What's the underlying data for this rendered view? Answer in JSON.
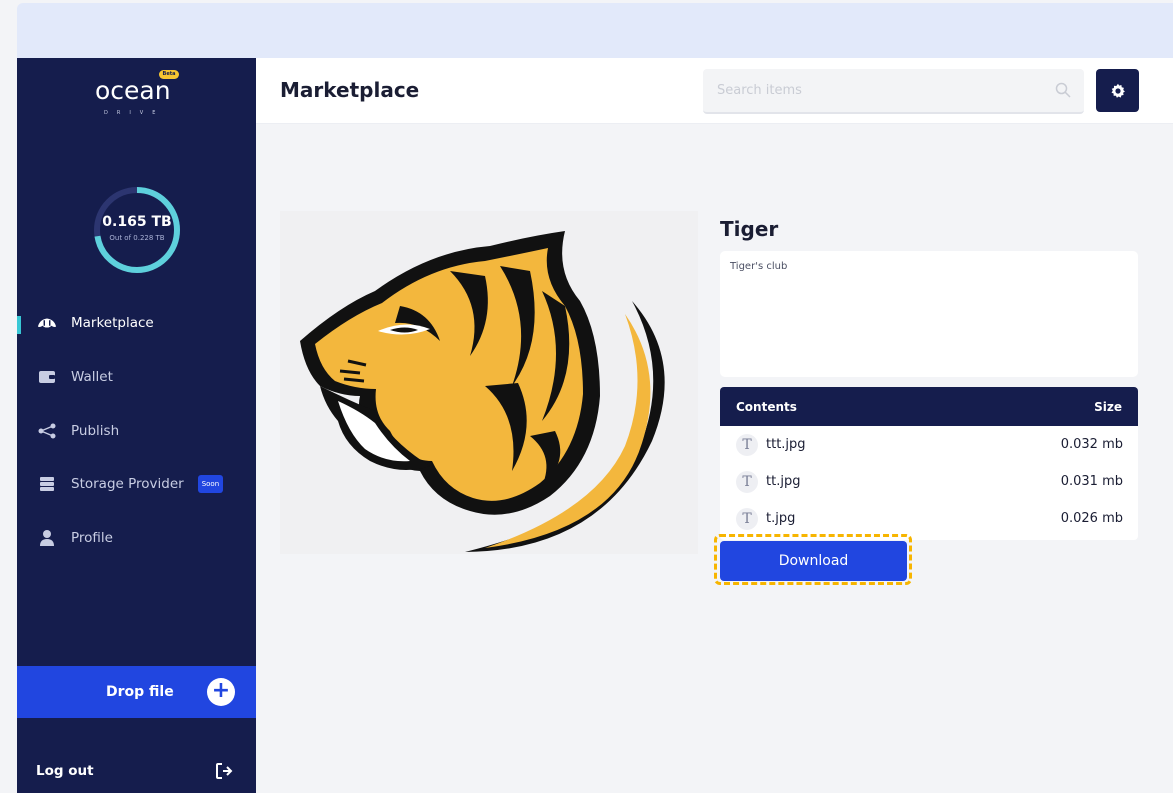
{
  "app": {
    "logo_text": "ocean",
    "logo_sub": "DRIVE",
    "logo_badge": "Beta"
  },
  "storage": {
    "used": "0.165 TB",
    "total": "Out of 0.228 TB",
    "used_fraction": 0.724,
    "ring_color": "#5ed0dc",
    "track_color": "#2c3570"
  },
  "sidebar": {
    "items": [
      {
        "label": "Marketplace",
        "icon": "tiger-mask-icon",
        "active": true
      },
      {
        "label": "Wallet",
        "icon": "wallet-icon"
      },
      {
        "label": "Publish",
        "icon": "share-icon"
      },
      {
        "label": "Storage Provider",
        "icon": "server-icon",
        "badge": "Soon"
      },
      {
        "label": "Profile",
        "icon": "user-icon"
      }
    ],
    "drop_file": "Drop file",
    "logout": "Log out"
  },
  "header": {
    "title": "Marketplace",
    "search_placeholder": "Search items"
  },
  "item": {
    "title": "Tiger",
    "description": "Tiger's club",
    "image_alt": "tiger-logo-image"
  },
  "contents": {
    "header_left": "Contents",
    "header_right": "Size",
    "files": [
      {
        "icon": "T",
        "name": "ttt.jpg",
        "size": "0.032 mb"
      },
      {
        "icon": "T",
        "name": "tt.jpg",
        "size": "0.031 mb"
      },
      {
        "icon": "T",
        "name": "t.jpg",
        "size": "0.026 mb"
      }
    ]
  },
  "download_label": "Download",
  "colors": {
    "sidebar": "#151d4d",
    "accent": "#2146e0",
    "highlight": "#f7b500"
  }
}
